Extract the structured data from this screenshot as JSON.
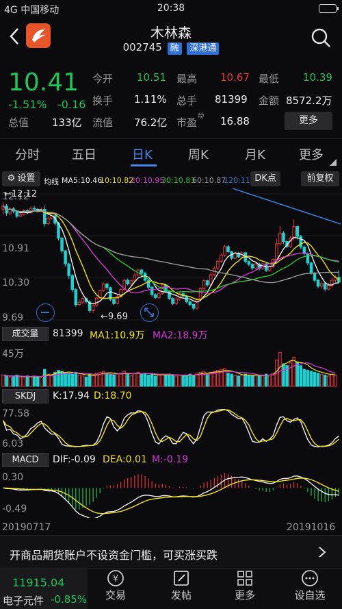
{
  "status_bar": {
    "carrier": "4G 中国移动",
    "time": "20:38"
  },
  "header": {
    "title": "木林森",
    "code": "002745",
    "tags": [
      "融",
      "深港通"
    ]
  },
  "quote": {
    "price": "10.41",
    "change_pct": "-1.51%",
    "change": "-0.16",
    "row1": [
      {
        "label": "今开",
        "value": "10.51"
      },
      {
        "label": "最高",
        "value": "10.67"
      },
      {
        "label": "最低",
        "value": "10.39"
      }
    ],
    "row2": [
      {
        "label": "换手",
        "value": "1.11%"
      },
      {
        "label": "总手",
        "value": "81399"
      },
      {
        "label": "金额",
        "value": "8572.2万"
      }
    ],
    "row3_label": "总值",
    "row3_value": "133亿",
    "row3b_label": "流值",
    "row3b_value": "76.2亿",
    "row3c_label": "市盈",
    "row3c_sup": "动",
    "row3c_value": "16.88",
    "more_label": "更多"
  },
  "tabs": [
    "分时",
    "五日",
    "日K",
    "周K",
    "月K",
    "更多"
  ],
  "active_tab": "日K",
  "kline": {
    "settings_label": "设置",
    "ma_title": "均线",
    "ma": [
      {
        "label": "MA5:10.46",
        "color": "#f0f0f0"
      },
      {
        "label": "10:10.82",
        "color": "#f2e21b"
      },
      {
        "label": "20:10.95",
        "color": "#d43ad4"
      },
      {
        "label": "30:10.83",
        "color": "#31c431"
      },
      {
        "label": "60:10.87",
        "color": "#9a9a9a"
      },
      {
        "label": "120:11",
        "color": "#3c7ad6"
      }
    ],
    "dk_label": "DK点",
    "fq_label": "前复权",
    "y_labels": [
      "12.12",
      "10.91",
      "10.30",
      "9.69"
    ],
    "low_marker": "9.69",
    "high_marker": "12.12",
    "candles": [
      [
        11.97,
        12.04,
        11.86,
        12.12
      ],
      [
        12.04,
        11.89,
        11.83,
        12.08
      ],
      [
        11.89,
        11.98,
        11.85,
        12.02
      ],
      [
        11.98,
        11.93,
        11.88,
        12.02
      ],
      [
        11.93,
        11.82,
        11.78,
        11.95
      ],
      [
        11.82,
        11.86,
        11.8,
        11.92
      ],
      [
        11.86,
        11.94,
        11.83,
        11.97
      ],
      [
        11.94,
        11.91,
        11.86,
        11.98
      ],
      [
        11.91,
        11.99,
        11.87,
        12.03
      ],
      [
        11.99,
        11.97,
        11.92,
        12.04
      ],
      [
        11.97,
        11.95,
        11.9,
        12.0
      ],
      [
        11.95,
        11.97,
        11.91,
        12.01
      ],
      [
        11.97,
        11.66,
        11.6,
        12.05
      ],
      [
        11.66,
        11.78,
        11.63,
        11.82
      ],
      [
        11.78,
        11.83,
        11.75,
        11.86
      ],
      [
        11.83,
        11.67,
        11.62,
        11.86
      ],
      [
        11.67,
        11.35,
        11.3,
        11.7
      ],
      [
        11.35,
        11.08,
        11.02,
        11.38
      ],
      [
        11.08,
        10.8,
        10.74,
        11.1
      ],
      [
        10.8,
        10.55,
        10.48,
        10.83
      ],
      [
        10.55,
        10.25,
        10.19,
        10.58
      ],
      [
        10.25,
        9.93,
        9.88,
        10.28
      ],
      [
        9.93,
        9.98,
        9.9,
        10.05
      ],
      [
        9.98,
        10.06,
        9.94,
        10.1
      ],
      [
        10.06,
        9.99,
        9.95,
        10.08
      ],
      [
        9.99,
        9.8,
        9.75,
        10.02
      ],
      [
        9.8,
        9.91,
        9.75,
        9.95
      ],
      [
        9.91,
        10.07,
        9.88,
        10.09
      ],
      [
        10.07,
        10.23,
        10.04,
        10.25
      ],
      [
        10.23,
        10.37,
        10.2,
        10.4
      ],
      [
        10.37,
        10.29,
        10.25,
        10.39
      ],
      [
        10.29,
        10.04,
        10.0,
        10.31
      ],
      [
        10.04,
        9.95,
        9.92,
        10.06
      ],
      [
        9.95,
        10.1,
        9.93,
        10.14
      ],
      [
        10.1,
        10.25,
        10.08,
        10.28
      ],
      [
        10.25,
        10.45,
        10.22,
        10.48
      ],
      [
        10.45,
        10.37,
        10.34,
        10.49
      ],
      [
        10.37,
        10.44,
        10.32,
        10.47
      ],
      [
        10.44,
        10.56,
        10.4,
        10.6
      ],
      [
        10.56,
        10.67,
        10.54,
        10.7
      ],
      [
        10.67,
        10.6,
        10.54,
        10.7
      ],
      [
        10.6,
        10.45,
        10.41,
        10.63
      ],
      [
        10.45,
        10.3,
        10.26,
        10.47
      ],
      [
        10.3,
        10.14,
        10.1,
        10.33
      ],
      [
        10.14,
        10.08,
        10.05,
        10.17
      ],
      [
        10.08,
        10.17,
        10.04,
        10.2
      ],
      [
        10.17,
        10.35,
        10.14,
        10.38
      ],
      [
        10.35,
        10.21,
        10.18,
        10.37
      ],
      [
        10.21,
        10.06,
        10.03,
        10.24
      ],
      [
        10.06,
        9.95,
        9.92,
        10.08
      ],
      [
        9.95,
        10.05,
        9.92,
        10.09
      ],
      [
        10.05,
        10.16,
        10.01,
        10.2
      ],
      [
        10.16,
        10.11,
        10.08,
        10.19
      ],
      [
        10.11,
        9.99,
        9.95,
        10.14
      ],
      [
        9.99,
        9.93,
        9.89,
        10.02
      ],
      [
        9.93,
        9.85,
        9.8,
        9.96
      ],
      [
        9.85,
        10.04,
        9.82,
        10.07
      ],
      [
        10.04,
        10.27,
        10.01,
        10.3
      ],
      [
        10.27,
        10.44,
        10.24,
        10.47
      ],
      [
        10.44,
        10.35,
        10.31,
        10.46
      ],
      [
        10.35,
        10.57,
        10.31,
        10.62
      ],
      [
        10.57,
        10.71,
        10.53,
        10.75
      ],
      [
        10.71,
        10.86,
        10.67,
        10.89
      ],
      [
        10.86,
        10.99,
        10.82,
        11.03
      ],
      [
        10.99,
        11.17,
        10.95,
        11.21
      ],
      [
        11.17,
        11.06,
        11.03,
        11.2
      ],
      [
        11.06,
        10.92,
        10.88,
        11.08
      ],
      [
        10.92,
        11.03,
        10.89,
        11.07
      ],
      [
        11.03,
        10.95,
        10.92,
        11.06
      ],
      [
        10.95,
        11.04,
        10.92,
        11.07
      ],
      [
        11.04,
        10.85,
        10.81,
        11.06
      ],
      [
        10.85,
        10.79,
        10.75,
        10.88
      ],
      [
        10.79,
        10.71,
        10.66,
        10.82
      ],
      [
        10.71,
        10.8,
        10.68,
        10.84
      ],
      [
        10.8,
        10.7,
        10.66,
        10.83
      ],
      [
        10.7,
        10.8,
        10.67,
        10.84
      ],
      [
        10.8,
        10.66,
        10.63,
        10.83
      ],
      [
        10.66,
        10.74,
        10.63,
        10.77
      ],
      [
        10.74,
        10.9,
        10.71,
        10.92
      ],
      [
        10.9,
        11.23,
        10.88,
        11.34
      ],
      [
        11.23,
        11.46,
        11.2,
        11.61
      ],
      [
        11.46,
        11.28,
        11.22,
        11.5
      ],
      [
        11.28,
        11.17,
        11.14,
        11.3
      ],
      [
        11.17,
        11.35,
        11.14,
        11.4
      ],
      [
        11.35,
        11.6,
        11.3,
        11.75
      ],
      [
        11.6,
        11.39,
        11.32,
        11.63
      ],
      [
        11.39,
        11.16,
        11.11,
        11.42
      ],
      [
        11.16,
        11.02,
        10.98,
        11.19
      ],
      [
        11.02,
        10.82,
        10.77,
        11.05
      ],
      [
        10.82,
        10.6,
        10.57,
        10.85
      ],
      [
        10.6,
        10.45,
        10.4,
        10.63
      ],
      [
        10.45,
        10.32,
        10.28,
        10.48
      ],
      [
        10.32,
        10.38,
        10.27,
        10.43
      ],
      [
        10.38,
        10.26,
        10.21,
        10.41
      ],
      [
        10.26,
        10.34,
        10.23,
        10.4
      ],
      [
        10.34,
        10.45,
        10.3,
        10.5
      ],
      [
        10.45,
        10.51,
        10.4,
        10.55
      ],
      [
        10.51,
        10.41,
        10.39,
        10.67
      ]
    ]
  },
  "volume": {
    "label": "成交量",
    "value": "81399",
    "ma1": "MA1:10.9万",
    "ma2": "MA2:18.9万",
    "max_label": "45万",
    "bars": [
      12,
      11,
      10,
      11,
      12,
      10,
      9,
      11,
      10,
      11,
      10,
      9,
      18,
      13,
      12,
      15,
      17,
      16,
      14,
      14,
      13,
      15,
      12,
      11,
      10,
      13,
      12,
      14,
      15,
      16,
      14,
      13,
      12,
      13,
      14,
      16,
      13,
      12,
      14,
      15,
      13,
      14,
      12,
      13,
      11,
      12,
      13,
      12,
      13,
      12,
      11,
      12,
      11,
      12,
      13,
      12,
      14,
      15,
      16,
      13,
      15,
      16,
      17,
      18,
      19,
      14,
      13,
      12,
      11,
      12,
      13,
      12,
      11,
      12,
      11,
      12,
      13,
      12,
      14,
      28,
      36,
      24,
      22,
      25,
      31,
      26,
      22,
      18,
      17,
      16,
      15,
      14,
      13,
      12,
      11,
      13,
      12
    ]
  },
  "skdj": {
    "label": "SKDJ",
    "k": "K:17.94",
    "d": "D:18.70",
    "y_top": "77.58",
    "y_bottom": "6.03"
  },
  "macd": {
    "label": "MACD",
    "dif": "DIF:-0.09",
    "dea": "DEA:0.01",
    "m": "M:-0.19",
    "y_top": "0.30",
    "y_bottom": "-0.49"
  },
  "date_start": "20190717",
  "date_end": "20191016",
  "banner": "开商品期货账户不设资金门槛，可买涨买跌",
  "bottom_nav": {
    "index_value": "11915.04",
    "index_name": "电子元件",
    "index_change": "-0.85%",
    "items": [
      "交易",
      "发帖",
      "更多",
      "设自选"
    ]
  }
}
